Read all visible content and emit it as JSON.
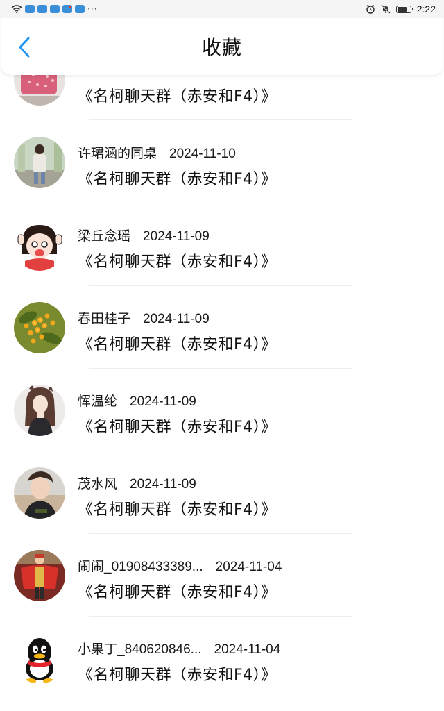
{
  "status_bar": {
    "time": "2:22",
    "icons": [
      "wifi-icon",
      "app-notification-icon",
      "alarm-icon",
      "mute-icon",
      "battery-icon"
    ],
    "overflow": "···"
  },
  "header": {
    "title": "收藏",
    "back_icon": "chevron-left-icon",
    "accent_color": "#2196f3"
  },
  "favorites": [
    {
      "name": "",
      "date": "",
      "title": "《名柯聊天群（赤安和F4）》"
    },
    {
      "name": "许珺涵的同桌",
      "date": "2024-11-10",
      "title": "《名柯聊天群（赤安和F4）》"
    },
    {
      "name": "梁丘念瑶",
      "date": "2024-11-09",
      "title": "《名柯聊天群（赤安和F4）》"
    },
    {
      "name": "春田桂子",
      "date": "2024-11-09",
      "title": "《名柯聊天群（赤安和F4）》"
    },
    {
      "name": "恽温纶",
      "date": "2024-11-09",
      "title": "《名柯聊天群（赤安和F4）》"
    },
    {
      "name": "茂水风",
      "date": "2024-11-09",
      "title": "《名柯聊天群（赤安和F4）》"
    },
    {
      "name": "闹闹_01908433389...",
      "date": "2024-11-04",
      "title": "《名柯聊天群（赤安和F4）》"
    },
    {
      "name": "小果丁_840620846...",
      "date": "2024-11-04",
      "title": "《名柯聊天群（赤安和F4）》"
    }
  ]
}
